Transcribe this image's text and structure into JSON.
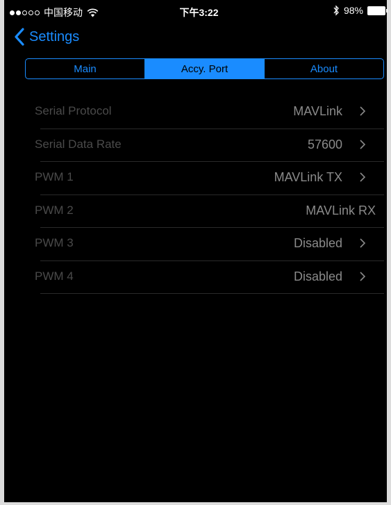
{
  "status_bar": {
    "carrier": "中国移动",
    "time": "下午3:22",
    "battery": "98%"
  },
  "nav": {
    "back_label": "Settings"
  },
  "tabs": [
    {
      "label": "Main",
      "active": false
    },
    {
      "label": "Accy. Port",
      "active": true
    },
    {
      "label": "About",
      "active": false
    }
  ],
  "rows": [
    {
      "label": "Serial Protocol",
      "value": "MAVLink",
      "has_chevron": true
    },
    {
      "label": "Serial Data Rate",
      "value": "57600",
      "has_chevron": true
    },
    {
      "label": "PWM 1",
      "value": "MAVLink TX",
      "has_chevron": true
    },
    {
      "label": "PWM 2",
      "value": "MAVLink RX",
      "has_chevron": false
    },
    {
      "label": "PWM 3",
      "value": "Disabled",
      "has_chevron": true
    },
    {
      "label": "PWM 4",
      "value": "Disabled",
      "has_chevron": true
    }
  ],
  "colors": {
    "accent": "#1a8cff",
    "background": "#000000",
    "label": "#4a4a4a",
    "value": "#8a8a8a"
  }
}
